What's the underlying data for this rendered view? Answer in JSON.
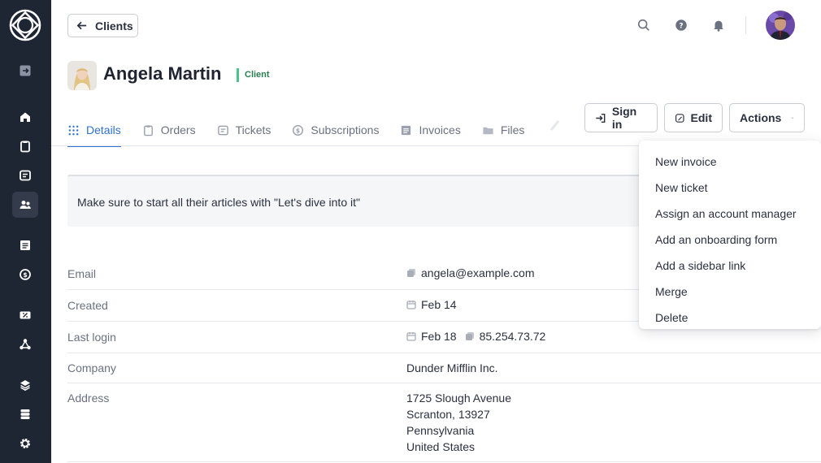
{
  "header": {
    "back_label": "Clients"
  },
  "client": {
    "name": "Angela Martin",
    "badge": "Client"
  },
  "tabs": [
    {
      "label": "Details",
      "icon": "grid-icon",
      "active": true
    },
    {
      "label": "Orders",
      "icon": "clipboard-icon"
    },
    {
      "label": "Tickets",
      "icon": "ticket-icon"
    },
    {
      "label": "Subscriptions",
      "icon": "dollar-cycle-icon"
    },
    {
      "label": "Invoices",
      "icon": "invoice-icon"
    },
    {
      "label": "Files",
      "icon": "folder-icon"
    }
  ],
  "actions": {
    "sign_in": "Sign in",
    "edit": "Edit",
    "actions": "Actions"
  },
  "note": "Make sure to start all their articles with \"Let's dive into it\"",
  "details": {
    "email_label": "Email",
    "email_value": "angela@example.com",
    "created_label": "Created",
    "created_value": "Feb 14",
    "last_login_label": "Last login",
    "last_login_value": "Feb 18",
    "last_login_ip": "85.254.73.72",
    "company_label": "Company",
    "company_value": "Dunder Mifflin Inc.",
    "address_label": "Address",
    "address_lines": [
      "1725 Slough Avenue",
      "Scranton, 13927",
      "Pennsylvania",
      "United States"
    ]
  },
  "menu": {
    "items": [
      "New invoice",
      "New ticket",
      "Assign an account manager",
      "Add an onboarding form",
      "Add a sidebar link",
      "Merge",
      "Delete"
    ]
  },
  "colors": {
    "sidebar": "#1e2533",
    "accent": "#2e72d2",
    "badge_green": "#4cc38a"
  }
}
